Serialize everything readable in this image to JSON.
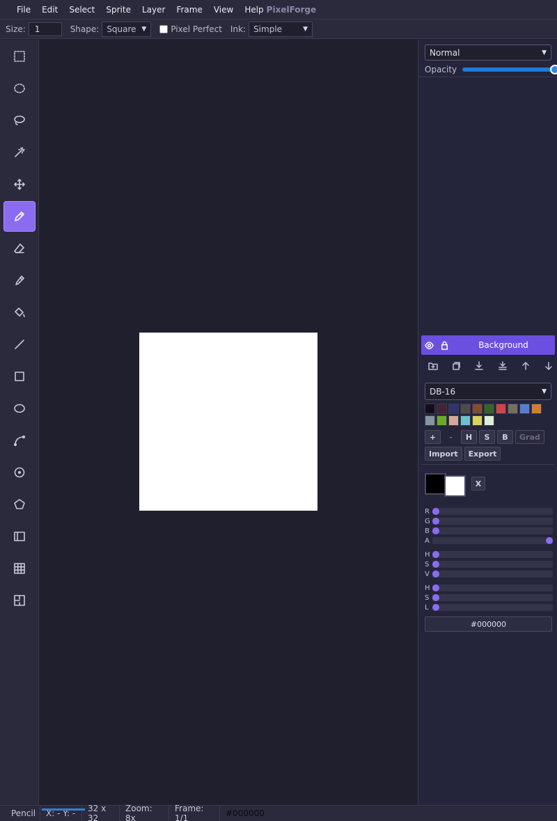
{
  "menubar": {
    "items": [
      "File",
      "Edit",
      "Select",
      "Sprite",
      "Layer",
      "Frame",
      "View",
      "Help"
    ],
    "app_title": "PixelForge"
  },
  "toolopts": {
    "size_label": "Size:",
    "size_value": "1",
    "shape_label": "Shape:",
    "shape_value": "Square",
    "pixel_perfect_label": "Pixel Perfect",
    "pixel_perfect_checked": false,
    "ink_label": "Ink:",
    "ink_value": "Simple"
  },
  "tools": [
    {
      "name": "rect-select-icon",
      "active": false
    },
    {
      "name": "ellipse-select-icon",
      "active": false
    },
    {
      "name": "lasso-icon",
      "active": false
    },
    {
      "name": "magic-wand-icon",
      "active": false
    },
    {
      "name": "move-icon",
      "active": false
    },
    {
      "name": "pencil-icon",
      "active": true
    },
    {
      "name": "eraser-icon",
      "active": false
    },
    {
      "name": "eyedropper-icon",
      "active": false
    },
    {
      "name": "fill-bucket-icon",
      "active": false
    },
    {
      "name": "line-icon",
      "active": false
    },
    {
      "name": "rectangle-icon",
      "active": false
    },
    {
      "name": "ellipse-icon",
      "active": false
    },
    {
      "name": "curve-icon",
      "active": false
    },
    {
      "name": "radial-icon",
      "active": false
    },
    {
      "name": "polygon-icon",
      "active": false
    },
    {
      "name": "columns-icon",
      "active": false
    },
    {
      "name": "grid-icon",
      "active": false
    },
    {
      "name": "slice-icon",
      "active": false
    }
  ],
  "canvas": {
    "background_color": "#ffffff"
  },
  "layers_panel": {
    "blend_mode": "Normal",
    "opacity_label": "Opacity",
    "opacity_value": 1.0,
    "layers": [
      {
        "name": "Background",
        "visible": true,
        "locked": false,
        "selected": true
      }
    ]
  },
  "palette": {
    "preset": "DB-16",
    "colors": [
      "#140c1c",
      "#442434",
      "#30346d",
      "#4e4a4e",
      "#854c30",
      "#346524",
      "#d04648",
      "#757161",
      "#597dce",
      "#d27d2c",
      "#8595a1",
      "#6daa2c",
      "#d2aa99",
      "#6dc2ca",
      "#dad45e",
      "#deeed6"
    ],
    "buttons": {
      "add": "+",
      "remove": "-",
      "sort_h": "H",
      "sort_s": "S",
      "sort_b": "B",
      "gradient": "Grad",
      "import": "Import",
      "export": "Export"
    }
  },
  "color_picker": {
    "fg_color": "#000000",
    "bg_color": "#ffffff",
    "swap_label": "X",
    "rgba": [
      {
        "label": "R",
        "value": 0,
        "max": 255
      },
      {
        "label": "G",
        "value": 0,
        "max": 255
      },
      {
        "label": "B",
        "value": 0,
        "max": 255
      },
      {
        "label": "A",
        "value": 255,
        "max": 255
      }
    ],
    "hsv": [
      {
        "label": "H",
        "value": 0,
        "max": 360
      },
      {
        "label": "S",
        "value": 0,
        "max": 100
      },
      {
        "label": "V",
        "value": 0,
        "max": 100
      }
    ],
    "hsl": [
      {
        "label": "H",
        "value": 0,
        "max": 360
      },
      {
        "label": "S",
        "value": 0,
        "max": 100
      },
      {
        "label": "L",
        "value": 0,
        "max": 100
      }
    ],
    "hex": "#000000"
  },
  "statusbar": {
    "tool": "Pencil",
    "coords": "X: - Y: -",
    "dimensions": "32 x 32",
    "zoom": "Zoom: 8x",
    "frame": "Frame: 1/1",
    "color": "#000000"
  },
  "colors": {
    "accent": "#8b6cf0",
    "layer_selected": "#6b4fe0"
  }
}
